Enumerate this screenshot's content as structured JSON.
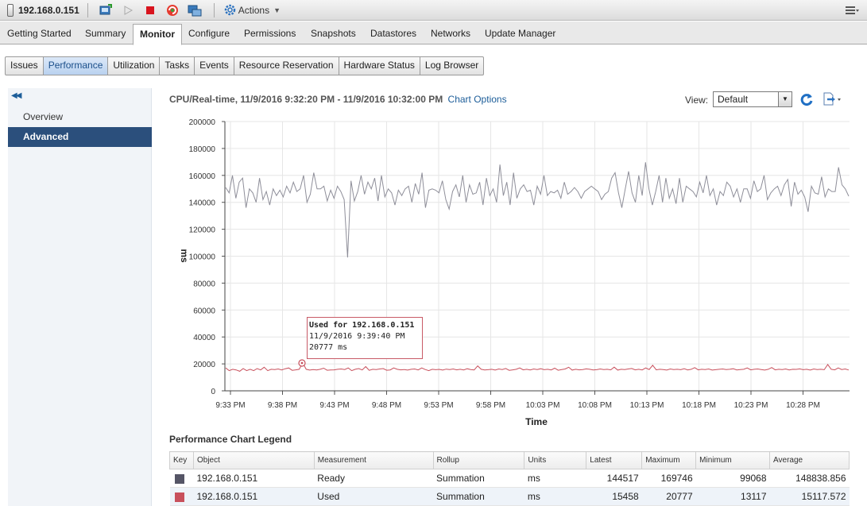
{
  "window": {
    "host_title": "192.168.0.151",
    "actions_label": "Actions"
  },
  "main_tabs": [
    {
      "label": "Getting Started"
    },
    {
      "label": "Summary"
    },
    {
      "label": "Monitor",
      "active": true
    },
    {
      "label": "Configure"
    },
    {
      "label": "Permissions"
    },
    {
      "label": "Snapshots"
    },
    {
      "label": "Datastores"
    },
    {
      "label": "Networks"
    },
    {
      "label": "Update Manager"
    }
  ],
  "sub_tabs": [
    {
      "label": "Issues"
    },
    {
      "label": "Performance",
      "active": true
    },
    {
      "label": "Utilization"
    },
    {
      "label": "Tasks"
    },
    {
      "label": "Events"
    },
    {
      "label": "Resource Reservation"
    },
    {
      "label": "Hardware Status"
    },
    {
      "label": "Log Browser"
    }
  ],
  "left_nav": [
    {
      "label": "Overview"
    },
    {
      "label": "Advanced",
      "active": true
    }
  ],
  "chart_header": {
    "title": "CPU/Real-time, 11/9/2016 9:32:20 PM - 11/9/2016 10:32:00 PM",
    "options_link": "Chart Options",
    "view_label": "View:",
    "view_value": "Default"
  },
  "tooltip": {
    "line1": "Used for 192.168.0.151",
    "line2": "11/9/2016 9:39:40 PM",
    "line3": "20777 ms"
  },
  "chart_data": {
    "type": "line",
    "xlabel": "Time",
    "ylabel": "ms",
    "ylim": [
      0,
      200000
    ],
    "yticks": [
      0,
      20000,
      40000,
      60000,
      80000,
      100000,
      120000,
      140000,
      160000,
      180000,
      200000
    ],
    "xlim_minutes": [
      0,
      60
    ],
    "xticks": [
      {
        "label": "9:33 PM",
        "t": 0
      },
      {
        "label": "9:38 PM",
        "t": 5
      },
      {
        "label": "9:43 PM",
        "t": 10
      },
      {
        "label": "9:48 PM",
        "t": 15
      },
      {
        "label": "9:53 PM",
        "t": 20
      },
      {
        "label": "9:58 PM",
        "t": 25
      },
      {
        "label": "10:03 PM",
        "t": 30
      },
      {
        "label": "10:08 PM",
        "t": 35
      },
      {
        "label": "10:13 PM",
        "t": 40
      },
      {
        "label": "10:18 PM",
        "t": 45
      },
      {
        "label": "10:23 PM",
        "t": 50
      },
      {
        "label": "10:28 PM",
        "t": 55
      }
    ],
    "grid": true,
    "series": [
      {
        "name": "Ready",
        "color": "#8e8e99",
        "values": [
          151000,
          147000,
          160000,
          143000,
          155000,
          158000,
          136000,
          150000,
          147000,
          140000,
          158000,
          142000,
          148000,
          138000,
          150000,
          145000,
          149000,
          144000,
          152000,
          147000,
          155000,
          148000,
          150000,
          160000,
          140000,
          146000,
          162000,
          150000,
          150000,
          152000,
          141000,
          149000,
          143000,
          152000,
          148000,
          142000,
          99068,
          156000,
          141000,
          148000,
          160000,
          146000,
          155000,
          150000,
          158000,
          141000,
          160000,
          144000,
          150000,
          147000,
          138000,
          149000,
          145000,
          150000,
          152000,
          140000,
          154000,
          146000,
          162000,
          136000,
          149000,
          150000,
          149000,
          147000,
          156000,
          142000,
          135000,
          148000,
          153000,
          144000,
          160000,
          140000,
          153000,
          146000,
          147000,
          155000,
          138000,
          158000,
          145000,
          150000,
          140000,
          168000,
          145000,
          155000,
          138000,
          162000,
          143000,
          150000,
          153000,
          148000,
          149000,
          138000,
          152000,
          146000,
          160000,
          145000,
          148000,
          147000,
          149000,
          143000,
          155000,
          146000,
          148000,
          151000,
          148000,
          143000,
          148000,
          150000,
          152000,
          150000,
          148000,
          142000,
          146000,
          148000,
          158000,
          162000,
          147000,
          136000,
          150000,
          163000,
          147000,
          140000,
          160000,
          145000,
          169746,
          150000,
          138000,
          148000,
          160000,
          140000,
          158000,
          143000,
          150000,
          139000,
          158000,
          140000,
          152000,
          150000,
          148000,
          144000,
          155000,
          147000,
          160000,
          145000,
          150000,
          138000,
          148000,
          145000,
          155000,
          152000,
          144000,
          150000,
          140000,
          150000,
          150000,
          143000,
          156000,
          148000,
          150000,
          160000,
          142000,
          147000,
          150000,
          152000,
          145000,
          153000,
          157000,
          137000,
          155000,
          146000,
          149000,
          144000,
          133000,
          152000,
          147000,
          146000,
          159000,
          144000,
          150000,
          148000,
          148000,
          166000,
          153000,
          150000,
          144517
        ]
      },
      {
        "name": "Used",
        "color": "#c8505c",
        "values": [
          17000,
          15000,
          16000,
          15500,
          14500,
          16500,
          15000,
          16000,
          15000,
          16500,
          15500,
          17500,
          15000,
          16000,
          15800,
          16200,
          15500,
          16400,
          17000,
          15200,
          15600,
          16000,
          20777,
          16000,
          15400,
          15800,
          15500,
          16000,
          16800,
          15300,
          15500,
          15600,
          16000,
          16200,
          15800,
          17000,
          15000,
          16000,
          16500,
          15500,
          18000,
          15200,
          16000,
          15800,
          16200,
          16500,
          15300,
          15500,
          17000,
          16000,
          15600,
          15800,
          15400,
          16000,
          16200,
          15500,
          17000,
          15800,
          15000,
          16000,
          15700,
          15900,
          15400,
          16100,
          15800,
          16200,
          15600,
          16000,
          15500,
          16400,
          15800,
          15500,
          18500,
          16000,
          15500,
          15700,
          16000,
          15400,
          16200,
          15800,
          16600,
          15200,
          15600,
          16000,
          17000,
          15600,
          16000,
          15500,
          16200,
          15800,
          16400,
          15700,
          16000,
          15500,
          16800,
          15300,
          15800,
          16200,
          17500,
          15400,
          16000,
          15600,
          15800,
          16300,
          16000,
          15500,
          15700,
          16200,
          15800,
          16000,
          15600,
          17600,
          15400,
          16000,
          15800,
          16200,
          16600,
          15600,
          16000,
          15500,
          17000,
          15800,
          19000,
          15600,
          16000,
          15800,
          15400,
          16200,
          15800,
          16000,
          15700,
          16400,
          15500,
          16000,
          17200,
          15600,
          16000,
          15800,
          16200,
          15400,
          15700,
          16000,
          16200,
          15800,
          16000,
          16400,
          15500,
          15800,
          16000,
          17000,
          15600,
          16000,
          16200,
          15800,
          15400,
          16000,
          17300,
          15600,
          16000,
          15800,
          16200,
          15500,
          16000,
          15900,
          16300,
          15700,
          16000,
          15400,
          16200,
          15800,
          16000,
          15700,
          19500,
          16000,
          15600,
          17000,
          15800,
          16200,
          15458
        ]
      }
    ]
  },
  "legend": {
    "title": "Performance Chart Legend",
    "columns": [
      "Key",
      "Object",
      "Measurement",
      "Rollup",
      "Units",
      "Latest",
      "Maximum",
      "Minimum",
      "Average"
    ],
    "rows": [
      {
        "color": "#555566",
        "object": "192.168.0.151",
        "measurement": "Ready",
        "rollup": "Summation",
        "units": "ms",
        "latest": "144517",
        "maximum": "169746",
        "minimum": "99068",
        "average": "148838.856"
      },
      {
        "color": "#c8505c",
        "object": "192.168.0.151",
        "measurement": "Used",
        "rollup": "Summation",
        "units": "ms",
        "latest": "15458",
        "maximum": "20777",
        "minimum": "13117",
        "average": "15117.572"
      }
    ]
  }
}
